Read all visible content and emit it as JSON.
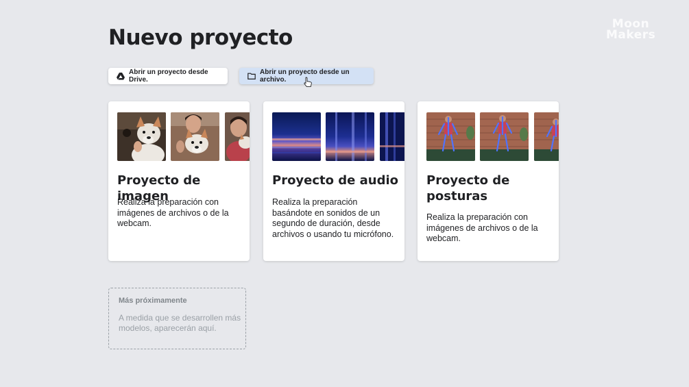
{
  "watermark": {
    "line1": "Moon",
    "line2": "Makers"
  },
  "page": {
    "title": "Nuevo proyecto"
  },
  "actions": {
    "drive_label": "Abrir un proyecto desde Drive.",
    "drive_icon": "google-drive-icon",
    "file_label": "Abrir un proyecto desde un archivo.",
    "file_icon": "folder-icon"
  },
  "cards": [
    {
      "title": "Proyecto de imagen",
      "description": "Realiza la preparación con imágenes de archivos o de la webcam.",
      "thumbnails": "webcam-photos-with-plush-dog"
    },
    {
      "title": "Proyecto de audio",
      "description": "Realiza la preparación basándote en sonidos de un segundo de duración, desde archivos o usando tu micrófono.",
      "thumbnails": "spectrograms"
    },
    {
      "title": "Proyecto de posturas",
      "description": "Realiza la preparación con imágenes de archivos o de la webcam.",
      "thumbnails": "pose-skeleton-photos"
    }
  ],
  "coming_soon": {
    "title": "Más próximamente",
    "description": "A medida que se desarrollen más modelos, aparecerán aquí."
  },
  "colors": {
    "background": "#e7e8ec",
    "card": "#ffffff",
    "selected_button": "#d3e1f5"
  }
}
